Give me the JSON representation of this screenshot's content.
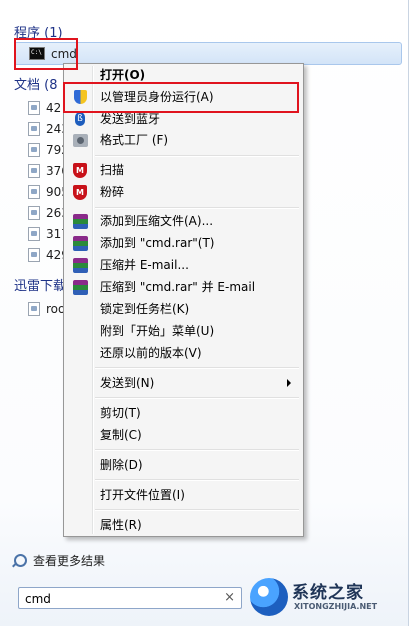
{
  "start_menu": {
    "groups": {
      "programs_header": "程序 (1)",
      "documents_header": "文档 (8",
      "downloads_header": "迅雷下载"
    },
    "program_item": "cmd",
    "document_items": [
      "42",
      "243",
      "792",
      "376",
      "905",
      "263",
      "317",
      "429"
    ],
    "download_items": [
      "roo"
    ],
    "see_more": "查看更多结果",
    "search_value": "cmd",
    "clear_glyph": "×"
  },
  "context_menu": {
    "items": [
      {
        "label": "打开(O)",
        "icon": "none",
        "bold": true
      },
      {
        "label": "以管理员身份运行(A)",
        "icon": "uac-shield-icon"
      },
      {
        "label": "发送到蓝牙",
        "icon": "bluetooth-icon"
      },
      {
        "label": "格式工厂 (F)",
        "icon": "format-factory-icon"
      },
      {
        "label": "扫描",
        "icon": "mcafee-icon"
      },
      {
        "label": "粉碎",
        "icon": "mcafee-icon"
      },
      {
        "label": "添加到压缩文件(A)...",
        "icon": "winrar-icon"
      },
      {
        "label": "添加到 \"cmd.rar\"(T)",
        "icon": "winrar-icon"
      },
      {
        "label": "压缩并 E-mail...",
        "icon": "winrar-icon"
      },
      {
        "label": "压缩到 \"cmd.rar\" 并 E-mail",
        "icon": "winrar-icon"
      },
      {
        "label": "锁定到任务栏(K)",
        "icon": "none"
      },
      {
        "label": "附到「开始」菜单(U)",
        "icon": "none"
      },
      {
        "label": "还原以前的版本(V)",
        "icon": "none"
      },
      {
        "label": "发送到(N)",
        "icon": "none",
        "submenu": true
      },
      {
        "label": "剪切(T)",
        "icon": "none"
      },
      {
        "label": "复制(C)",
        "icon": "none"
      },
      {
        "label": "删除(D)",
        "icon": "none"
      },
      {
        "label": "打开文件位置(I)",
        "icon": "none"
      },
      {
        "label": "属性(R)",
        "icon": "none"
      }
    ]
  },
  "watermark": {
    "title": "系统之家",
    "url": "XITONGZHIJIA.NET"
  },
  "colors": {
    "highlight_box": "#e0141e",
    "group_header": "#1e3287",
    "menu_background": "#f5f5f5"
  }
}
